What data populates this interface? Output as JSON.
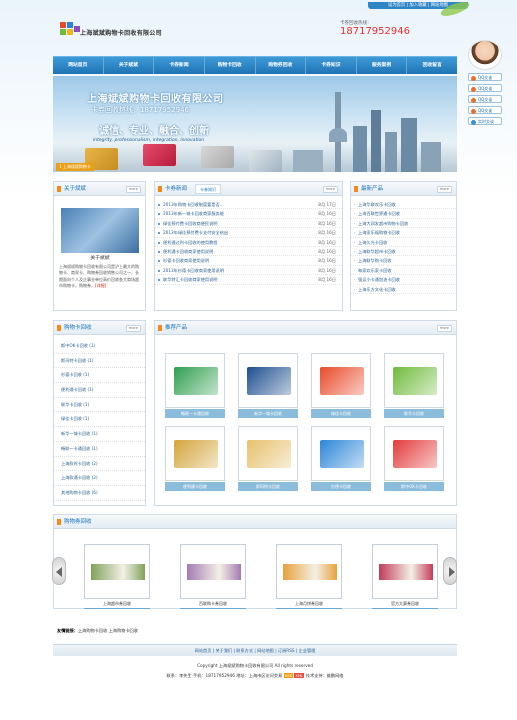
{
  "top_links": "设为首页 | 加入收藏 | 网站地图",
  "site": {
    "name": "上海斌斌购物卡回收有限公司",
    "hotline_label": "卡券回收热线：",
    "phone": "18717952946"
  },
  "nav": [
    "网站首页",
    "关于斌斌",
    "卡券新闻",
    "购物卡回收",
    "购物券回收",
    "卡券知识",
    "服务案例",
    "回收留言"
  ],
  "banner": {
    "title": "上海斌斌购物卡回收有限公司",
    "hotline": "卡券回收热线：18717952946",
    "slogan": "诚信、专业、融合、创新",
    "english": "integrity, professionalism, integration, innovation",
    "caption": "1 上海斌斌购物卡"
  },
  "qq": {
    "buttons": [
      "QQ交谈",
      "QQ交谈",
      "QQ交谈",
      "QQ交谈",
      "实时交谈"
    ]
  },
  "about": {
    "title": "关于斌斌",
    "more": "more",
    "name": "关于斌斌",
    "text": "上海斌斌购物卡回收有限公司是沪上最大的购物卡、商家卡、购物券回收销售公司之一，长期面向个人及企事业单位高价回收各大商场超市购物卡，购物券，",
    "detail": "[详细]"
  },
  "news": {
    "title": "卡券新闻",
    "tab": "卡券知识",
    "more": "more",
    "items": [
      {
        "text": "2013年购物卡回收制度要是否...",
        "date": "8月 17日"
      },
      {
        "text": "2013年新一城卡回收商家服务能",
        "date": "8月 16日"
      },
      {
        "text": "绿佳预付费卡回收商便民说明",
        "date": "8月 16日"
      },
      {
        "text": "2013年绿佳预付费卡支付安全给出",
        "date": "8月 16日"
      },
      {
        "text": "便利通过利卡回收的使用教程",
        "date": "8月 16日"
      },
      {
        "text": "便利通卡回收商家使用说明",
        "date": "8月 16日"
      },
      {
        "text": "杉德卡回收商家使用说明",
        "date": "8月 16日"
      },
      {
        "text": "2013年杉德卡回收商家使用说明",
        "date": "8月 16日"
      },
      {
        "text": "联华特汇卡回收商家使用说明",
        "date": "8月 16日"
      }
    ]
  },
  "latest": {
    "title": "最新产品",
    "more": "more",
    "items": [
      "上海华联欢乐卡回收",
      "上海百联世界通卡回收",
      "上海大润发超市购物卡回收",
      "上海家乐福购物卡回收",
      "上海久光卡回收",
      "上海联华超市卡回收",
      "上海联华购卡回收",
      "每家欢乐家卡回收",
      "强运小卡通加油卡回收",
      "上海乐方文化卡回收"
    ]
  },
  "categories": {
    "title": "购物卡回收",
    "more": "more",
    "items": [
      "斯中OK卡回收 (1)",
      "斯玛特卡回收 (1)",
      "杉德卡回收 (1)",
      "便利通卡回收 (1)",
      "联华卡回收 (1)",
      "绿佳卡回收 (1)",
      "新华一城卡回收 (1)",
      "畅联一卡通回收 (1)",
      "上海款时卡回收 (2)",
      "上海款通卡回收 (2)",
      "其他购物卡回收 (6)"
    ]
  },
  "products": {
    "title": "推荐产品",
    "more": "more",
    "items": [
      "畅联一卡通回收",
      "新华一城卡回收",
      "绿佳卡回收",
      "联华卡回收",
      "便利通卡回收",
      "斯玛特卡回收",
      "杉德卡回收",
      "斯中OK卡回收"
    ],
    "colors": [
      "#2f9e4f",
      "#1d4e8f",
      "#e94b2a",
      "#6fbb3c",
      "#d4a53b",
      "#e7c06c",
      "#2c86d8",
      "#e23b3b"
    ]
  },
  "coupons": {
    "title": "购物券回收",
    "items": [
      "上海超市券回收",
      "百联购卡券回收",
      "上海月饼券回收",
      "官方大赛券回收"
    ],
    "colors": [
      "#7fa25a",
      "#a47bb3",
      "#e6a23c",
      "#c23b5a"
    ]
  },
  "friend": {
    "label": "友情链接：",
    "links": "上海购物卡回收    上海购物卡回收"
  },
  "footer": {
    "nav": "网站首页  |  关于我们  |  联系方式  |  网站地图  |  订阅RSS  |  企业管理",
    "copyright": "Copyright 上海斌斌购物卡回收有限公司  All rights reserved",
    "contact": "联系：李先生  手机：18717952946 地址：上海市区访问交易",
    "badge1": "RSS",
    "badge2": "XML",
    "support": "技术支持：维鹏网络"
  }
}
